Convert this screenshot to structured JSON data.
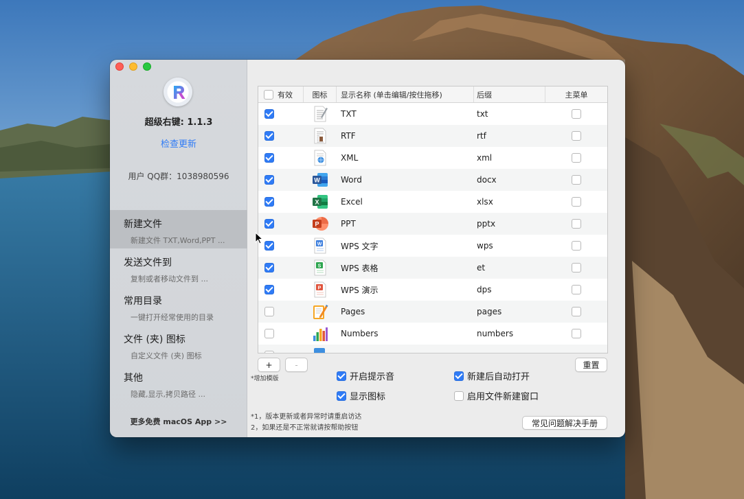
{
  "app": {
    "version_text": "超级右键: 1.1.3",
    "check_update": "检查更新",
    "qq_group": "用户 QQ群：1038980596",
    "more_apps": "更多免费 macOS App >>"
  },
  "nav": [
    {
      "title": "新建文件",
      "subtitle": "新建文件 TXT,Word,PPT ..."
    },
    {
      "title": "发送文件到",
      "subtitle": "复制或者移动文件到 ..."
    },
    {
      "title": "常用目录",
      "subtitle": "一键打开经常使用的目录"
    },
    {
      "title": "文件 (夹) 图标",
      "subtitle": "自定义文件 (夹) 图标"
    },
    {
      "title": "其他",
      "subtitle": "隐藏,显示,拷贝路径 ..."
    }
  ],
  "table": {
    "headers": {
      "enabled": "有效",
      "icon": "图标",
      "name": "显示名称 (单击编辑/按住拖移)",
      "suffix": "后缀",
      "main_menu": "主菜单"
    },
    "rows": [
      {
        "enabled": true,
        "icon": "txt-file-icon",
        "name": "TXT",
        "suffix": "txt",
        "main_menu": false
      },
      {
        "enabled": true,
        "icon": "rtf-file-icon",
        "name": "RTF",
        "suffix": "rtf",
        "main_menu": false
      },
      {
        "enabled": true,
        "icon": "xml-file-icon",
        "name": "XML",
        "suffix": "xml",
        "main_menu": false
      },
      {
        "enabled": true,
        "icon": "word-icon",
        "name": "Word",
        "suffix": "docx",
        "main_menu": false
      },
      {
        "enabled": true,
        "icon": "excel-icon",
        "name": "Excel",
        "suffix": "xlsx",
        "main_menu": false
      },
      {
        "enabled": true,
        "icon": "powerpoint-icon",
        "name": "PPT",
        "suffix": "pptx",
        "main_menu": false
      },
      {
        "enabled": true,
        "icon": "wps-writer-icon",
        "name": "WPS 文字",
        "suffix": "wps",
        "main_menu": false
      },
      {
        "enabled": true,
        "icon": "wps-spreadsheet-icon",
        "name": "WPS 表格",
        "suffix": "et",
        "main_menu": false
      },
      {
        "enabled": true,
        "icon": "wps-presentation-icon",
        "name": "WPS 演示",
        "suffix": "dps",
        "main_menu": false
      },
      {
        "enabled": false,
        "icon": "pages-icon",
        "name": "Pages",
        "suffix": "pages",
        "main_menu": false
      },
      {
        "enabled": false,
        "icon": "numbers-icon",
        "name": "Numbers",
        "suffix": "numbers",
        "main_menu": false
      }
    ]
  },
  "buttons": {
    "add": "+",
    "remove": "-",
    "add_hint": "*增加模版",
    "reset": "重置",
    "faq": "常见问题解决手册"
  },
  "options": {
    "sound": {
      "label": "开启提示音",
      "checked": true
    },
    "auto_open": {
      "label": "新建后自动打开",
      "checked": true
    },
    "show_icon": {
      "label": "显示图标",
      "checked": true
    },
    "new_window": {
      "label": "启用文件新建窗口",
      "checked": false
    }
  },
  "notes": {
    "line1": "*1，版本更新或者异常时请重启访达",
    "line2": "2，如果还是不正常就请按帮助按钮"
  },
  "colors": {
    "accent": "#2f7bf6",
    "word": "#2b579a",
    "excel": "#217346",
    "powerpoint": "#d24726",
    "wps_writer": "#3b7ddd",
    "wps_spreadsheet": "#2ea54f",
    "wps_presentation": "#e0553e"
  }
}
